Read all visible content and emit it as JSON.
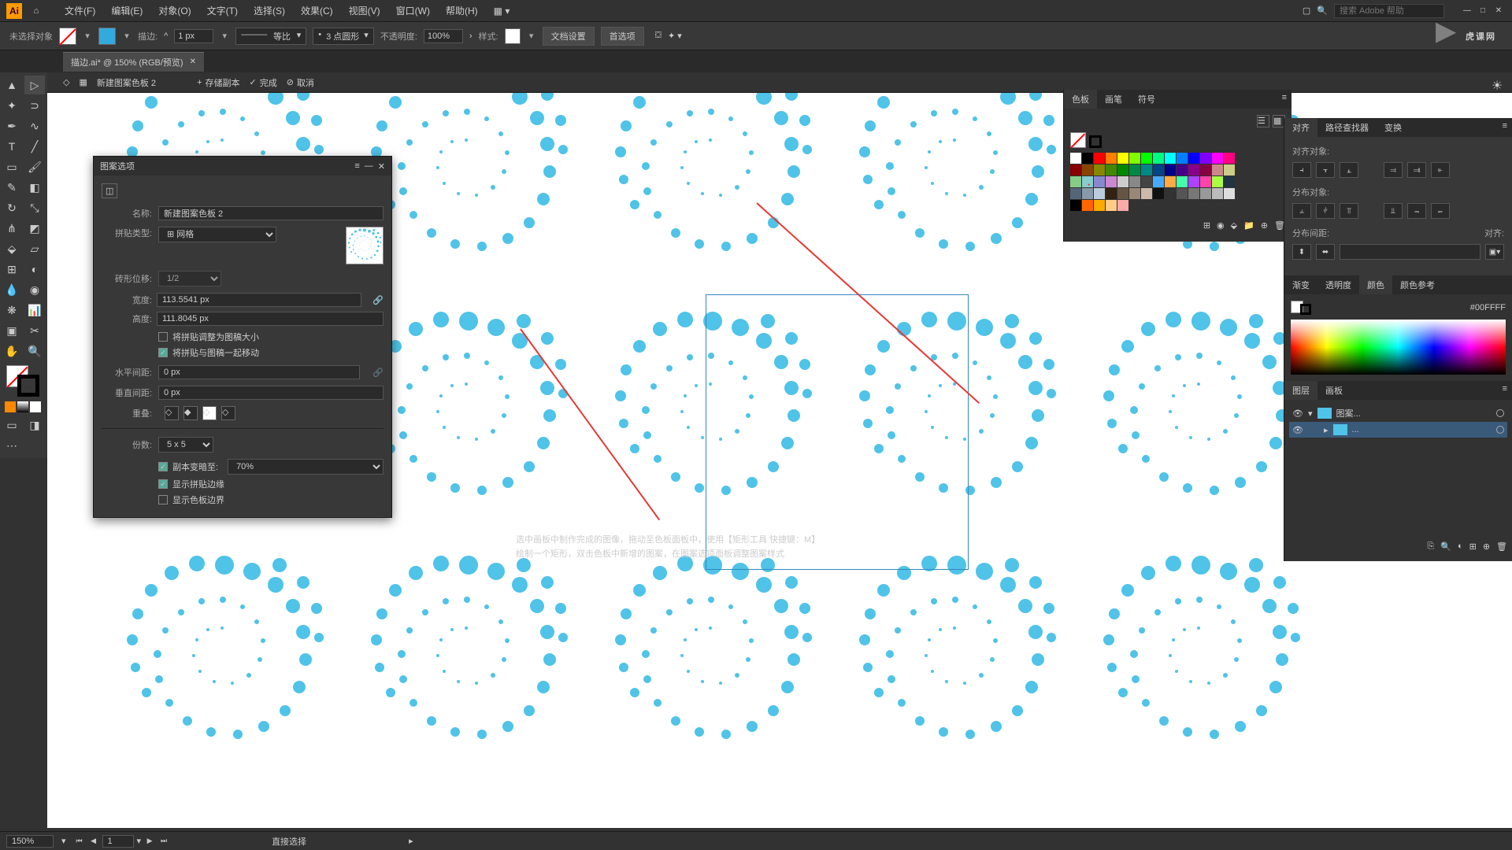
{
  "menu": {
    "items": [
      "文件(F)",
      "编辑(E)",
      "对象(O)",
      "文字(T)",
      "选择(S)",
      "效果(C)",
      "视图(V)",
      "窗口(W)",
      "帮助(H)"
    ],
    "search_ph": "搜索 Adobe 帮助"
  },
  "control": {
    "no_sel": "未选择对象",
    "stroke_lbl": "描边:",
    "stroke_val": "1 px",
    "profile": "等比",
    "pt_val": "3 点圆形",
    "opacity_lbl": "不透明度:",
    "opacity_val": "100%",
    "style_lbl": "样式:",
    "doc_setup": "文档设置",
    "prefs": "首选项"
  },
  "doc_tab": "描边.ai* @ 150% (RGB/预览)",
  "editbar": {
    "title": "新建图案色板 2",
    "save": "存储副本",
    "done": "完成",
    "cancel": "取消"
  },
  "pattern": {
    "title": "图案选项",
    "name_lbl": "名称:",
    "name": "新建图案色板 2",
    "tile_lbl": "拼贴类型:",
    "tile_type": "⊞ 网格",
    "brick_lbl": "砖形位移:",
    "brick_val": "1/2",
    "w_lbl": "宽度:",
    "w": "113.5541 px",
    "h_lbl": "高度:",
    "h": "111.8045 px",
    "ck1": "将拼贴调整为图稿大小",
    "ck2": "将拼贴与图稿一起移动",
    "hs_lbl": "水平间距:",
    "hs": "0 px",
    "vs_lbl": "垂直间距:",
    "vs": "0 px",
    "overlap_lbl": "重叠:",
    "copies_lbl": "份数:",
    "copies": "5 x 5",
    "dim_lbl": "副本变暗至:",
    "dim_val": "70%",
    "ck3": "显示拼贴边缘",
    "ck4": "显示色板边界"
  },
  "tabs": {
    "swatch": "色板",
    "brush": "画笔",
    "symbol": "符号",
    "align": "对齐",
    "pathf": "路径查找器",
    "transform": "变换",
    "grad": "渐变",
    "transp": "透明度",
    "color": "颜色",
    "cguide": "颜色参考",
    "layers": "图层",
    "artb": "画板"
  },
  "align": {
    "to": "对齐对象:",
    "dist": "分布对象:",
    "distsp": "分布间距:",
    "alignto": "对齐:"
  },
  "color": {
    "hex_pre": "#",
    "hex": "00FFFF"
  },
  "layers": {
    "l1": "图案...",
    "l2": "..."
  },
  "status": {
    "zoom": "150%",
    "page": "1",
    "tool": "直接选择"
  },
  "annot": {
    "l1": "选中画板中制作完成的图像，拖动至色板面板中，使用【矩形工具 快捷键：M】",
    "l2": "绘制一个矩形，双击色板中新增的图案，在图案选项面板调整图案样式"
  },
  "watermark": "虎课网",
  "swatch_colors": [
    "#fff",
    "#000",
    "#f00",
    "#ff8000",
    "#ff0",
    "#80ff00",
    "#0f0",
    "#00ff80",
    "#0ff",
    "#0080ff",
    "#00f",
    "#8000ff",
    "#f0f",
    "#ff0080",
    "#800",
    "#840",
    "#880",
    "#480",
    "#080",
    "#084",
    "#088",
    "#048",
    "#008",
    "#408",
    "#808",
    "#804",
    "#c88",
    "#cc8",
    "#8c8",
    "#8cc",
    "#88c",
    "#c8c",
    "#ccc",
    "#888",
    "#444",
    "#4af",
    "#fa4",
    "#4fa",
    "#a4f",
    "#f4a",
    "#af4",
    "#234",
    "#567",
    "#89a",
    "#bcd",
    "#321",
    "#654",
    "#987",
    "#cba",
    "#111",
    "#333",
    "#555",
    "#777",
    "#999",
    "#bbb",
    "#ddd",
    "#000",
    "#f60",
    "#fa0",
    "#fc8",
    "#faa"
  ]
}
